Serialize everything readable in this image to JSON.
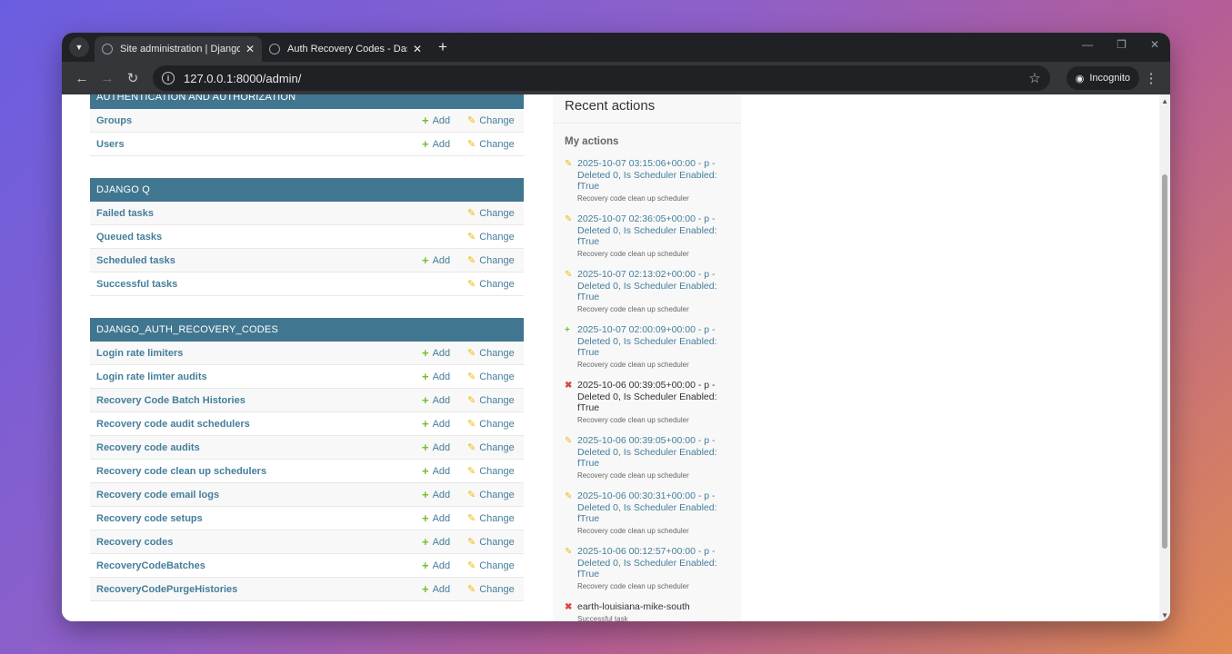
{
  "browser": {
    "tabs": [
      {
        "title": "Site administration | Django site admin",
        "active": true
      },
      {
        "title": "Auth Recovery Codes - Dashboard",
        "active": false
      }
    ],
    "url": "127.0.0.1:8000/admin/",
    "incognito_label": "Incognito"
  },
  "modules": [
    {
      "caption": "AUTHENTICATION AND AUTHORIZATION",
      "rows": [
        {
          "name": "Groups",
          "add": "Add",
          "change": "Change"
        },
        {
          "name": "Users",
          "add": "Add",
          "change": "Change"
        }
      ]
    },
    {
      "caption": "DJANGO Q",
      "rows": [
        {
          "name": "Failed tasks",
          "add": "",
          "change": "Change"
        },
        {
          "name": "Queued tasks",
          "add": "",
          "change": "Change"
        },
        {
          "name": "Scheduled tasks",
          "add": "Add",
          "change": "Change"
        },
        {
          "name": "Successful tasks",
          "add": "",
          "change": "Change"
        }
      ]
    },
    {
      "caption": "DJANGO_AUTH_RECOVERY_CODES",
      "rows": [
        {
          "name": "Login rate limiters",
          "add": "Add",
          "change": "Change"
        },
        {
          "name": "Login rate limter audits",
          "add": "Add",
          "change": "Change"
        },
        {
          "name": "Recovery Code Batch Histories",
          "add": "Add",
          "change": "Change"
        },
        {
          "name": "Recovery code audit schedulers",
          "add": "Add",
          "change": "Change"
        },
        {
          "name": "Recovery code audits",
          "add": "Add",
          "change": "Change"
        },
        {
          "name": "Recovery code clean up schedulers",
          "add": "Add",
          "change": "Change"
        },
        {
          "name": "Recovery code email logs",
          "add": "Add",
          "change": "Change"
        },
        {
          "name": "Recovery code setups",
          "add": "Add",
          "change": "Change"
        },
        {
          "name": "Recovery codes",
          "add": "Add",
          "change": "Change"
        },
        {
          "name": "RecoveryCodeBatches",
          "add": "Add",
          "change": "Change"
        },
        {
          "name": "RecoveryCodePurgeHistories",
          "add": "Add",
          "change": "Change"
        }
      ]
    }
  ],
  "recent": {
    "title": "Recent actions",
    "subtitle": "My actions",
    "actions": [
      {
        "type": "edit",
        "text": "2025-10-07 03:15:06+00:00 - p - Deleted 0, Is Scheduler Enabled: fTrue",
        "meta": "Recovery code clean up scheduler"
      },
      {
        "type": "edit",
        "text": "2025-10-07 02:36:05+00:00 - p - Deleted 0, Is Scheduler Enabled: fTrue",
        "meta": "Recovery code clean up scheduler"
      },
      {
        "type": "edit",
        "text": "2025-10-07 02:13:02+00:00 - p - Deleted 0, Is Scheduler Enabled: fTrue",
        "meta": "Recovery code clean up scheduler"
      },
      {
        "type": "add",
        "text": "2025-10-07 02:00:09+00:00 - p - Deleted 0, Is Scheduler Enabled: fTrue",
        "meta": "Recovery code clean up scheduler"
      },
      {
        "type": "delete",
        "text": "2025-10-06 00:39:05+00:00 - p - Deleted 0, Is Scheduler Enabled: fTrue",
        "meta": "Recovery code clean up scheduler"
      },
      {
        "type": "edit",
        "text": "2025-10-06 00:39:05+00:00 - p - Deleted 0, Is Scheduler Enabled: fTrue",
        "meta": "Recovery code clean up scheduler"
      },
      {
        "type": "edit",
        "text": "2025-10-06 00:30:31+00:00 - p - Deleted 0, Is Scheduler Enabled: fTrue",
        "meta": "Recovery code clean up scheduler"
      },
      {
        "type": "edit",
        "text": "2025-10-06 00:12:57+00:00 - p - Deleted 0, Is Scheduler Enabled: fTrue",
        "meta": "Recovery code clean up scheduler"
      },
      {
        "type": "delete",
        "text": "earth-louisiana-mike-south",
        "meta": "Successful task"
      }
    ]
  },
  "colors": {
    "module_header": "#417690",
    "link": "#447e9b",
    "add_icon": "#70bf2b",
    "change_icon": "#efb80b",
    "delete_icon": "#dd4646"
  }
}
